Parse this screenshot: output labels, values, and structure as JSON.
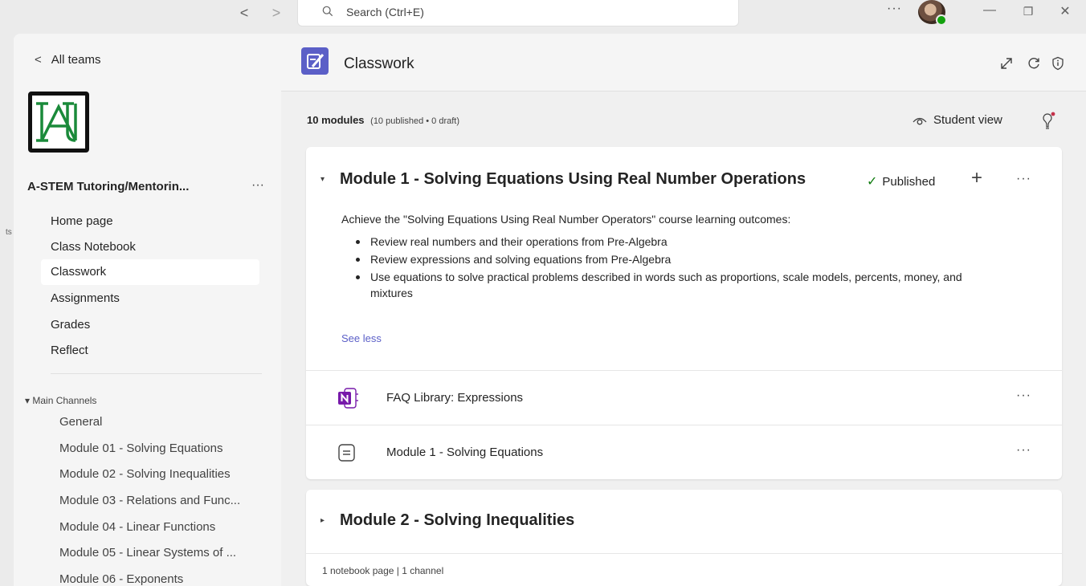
{
  "titlebar": {
    "back_arrow": "<",
    "forward_arrow": ">",
    "search_placeholder": "Search (Ctrl+E)",
    "more": "···",
    "minimize": "—",
    "restore": "❐",
    "close": "✕"
  },
  "rail": {
    "partial_text": "ts"
  },
  "sidebar": {
    "back_label": "All teams",
    "back_chevron": "<",
    "team_name": "A-STEM Tutoring/Mentorin...",
    "team_more": "···",
    "nav": [
      {
        "label": "Home page",
        "active": false
      },
      {
        "label": "Class Notebook",
        "active": false
      },
      {
        "label": "Classwork",
        "active": true
      },
      {
        "label": "Assignments",
        "active": false
      },
      {
        "label": "Grades",
        "active": false
      },
      {
        "label": "Reflect",
        "active": false
      }
    ],
    "channels_header": "▾ Main Channels",
    "channels": [
      "General",
      "Module 01 - Solving Equations",
      "Module 02 - Solving Inequalities",
      "Module 03 - Relations and Func...",
      "Module 04 - Linear Functions",
      "Module 05 - Linear Systems of ...",
      "Module 06 - Exponents"
    ]
  },
  "main": {
    "title": "Classwork",
    "summary_count": "10 modules",
    "summary_detail": "(10 published • 0 draft)",
    "student_view": "Student view",
    "modules": [
      {
        "caret": "▾",
        "title": "Module 1 - Solving Equations Using Real Number Operations",
        "status": "Published",
        "status_check": "✓",
        "plus": "+",
        "more": "···",
        "description": "Achieve the \"Solving Equations Using Real Number Operators\" course learning outcomes:",
        "bullets": [
          "Review real numbers and their operations from Pre-Algebra",
          "Review expressions and solving equations from Pre-Algebra",
          "Use equations to solve practical problems described in words such as proportions, scale models, percents, money, and mixtures"
        ],
        "see_less": "See less",
        "items": [
          {
            "label": "FAQ Library: Expressions",
            "icon": "onenote-icon",
            "more": "···"
          },
          {
            "label": "Module 1 - Solving Equations",
            "icon": "channel-post-icon",
            "more": "···"
          }
        ]
      },
      {
        "caret": "▸",
        "title": "Module 2 - Solving Inequalities",
        "footer": "1 notebook page  |  1 channel"
      }
    ]
  },
  "colors": {
    "accent": "#5b5fc7",
    "published_check": "#107c10",
    "onenote": "#7719aa",
    "presence_available": "#13a10e",
    "notification_dot": "#c4314b",
    "logo_green": "#1a8a3a"
  }
}
